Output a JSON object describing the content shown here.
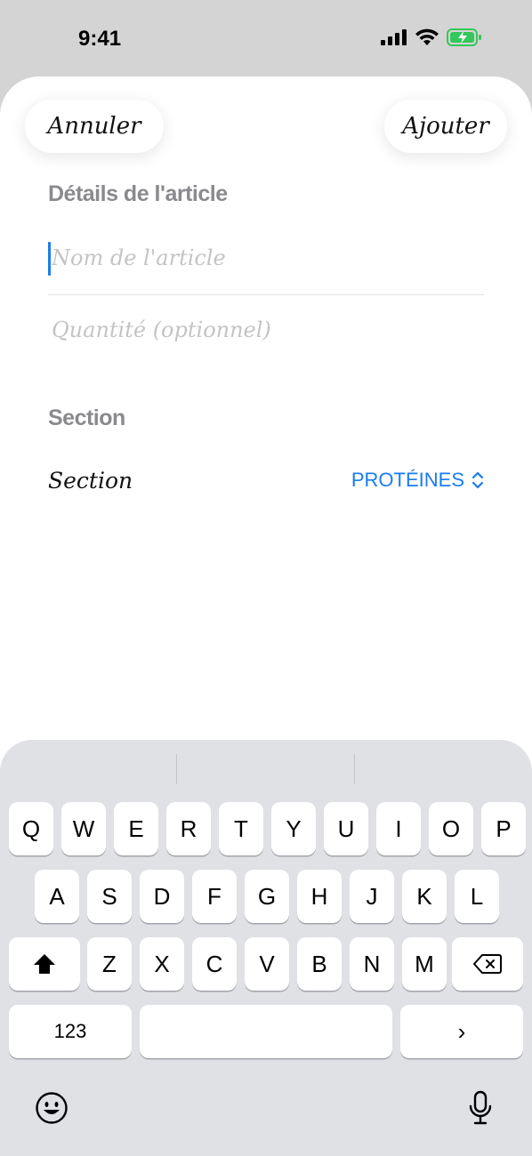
{
  "status_bar": {
    "time": "9:41"
  },
  "toolbar": {
    "cancel_label": "Annuler",
    "add_label": "Ajouter"
  },
  "details": {
    "header": "Détails de l'article",
    "name_placeholder": "Nom de l'article",
    "quantity_placeholder": "Quantité (optionnel)"
  },
  "section": {
    "header": "Section",
    "label": "Section",
    "selected_value": "PROTÉINES"
  },
  "keyboard": {
    "row1": [
      "Q",
      "W",
      "E",
      "R",
      "T",
      "Y",
      "U",
      "I",
      "O",
      "P"
    ],
    "row2": [
      "A",
      "S",
      "D",
      "F",
      "G",
      "H",
      "J",
      "K",
      "L"
    ],
    "row3": [
      "Z",
      "X",
      "C",
      "V",
      "B",
      "N",
      "M"
    ],
    "numbers_label": "123",
    "next_label": "›"
  },
  "colors": {
    "accent": "#1a7cf0",
    "battery": "#34c759"
  },
  "icons": [
    "signal-icon",
    "wifi-icon",
    "battery-charging-icon",
    "up-down-chevron-icon",
    "shift-icon",
    "delete-icon",
    "emoji-icon",
    "microphone-icon"
  ]
}
